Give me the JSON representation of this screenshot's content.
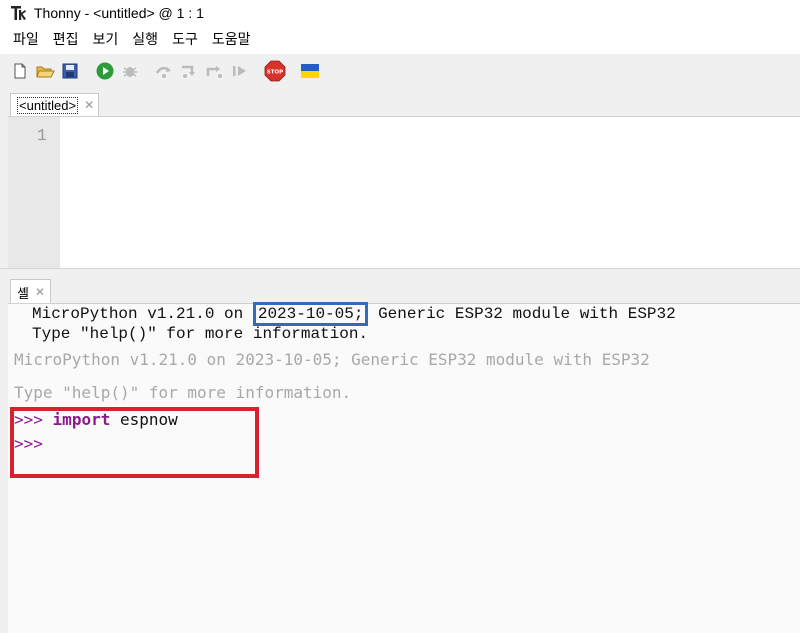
{
  "window": {
    "app_name": "Thonny",
    "separator": "-",
    "document": "<untitled>",
    "at": "@",
    "position": "1 : 1"
  },
  "menu": [
    "파일",
    "편집",
    "보기",
    "실행",
    "도구",
    "도움말"
  ],
  "toolbar": {
    "icons": [
      "new-file-icon",
      "open-file-icon",
      "save-file-icon",
      "run-icon",
      "debug-icon",
      "step-over-icon",
      "step-into-icon",
      "step-out-icon",
      "resume-icon",
      "stop-icon",
      "ukraine-flag-icon"
    ],
    "stop_label": "STOP",
    "colors": {
      "run": "#2e9b3a",
      "stop": "#d8322b",
      "flag_blue": "#1f5fbf",
      "flag_yellow": "#ffd500"
    }
  },
  "editor": {
    "tab_label": "<untitled>",
    "line_number": "1"
  },
  "shell": {
    "tab_label": "셸",
    "banner": {
      "prefix": "MicroPython v1.21.0 on ",
      "date": "2023-10-05;",
      "suffix": " Generic ESP32 module with ESP32",
      "help": "Type \"help()\" for more information."
    },
    "echo_line1": "MicroPython v1.21.0 on 2023-10-05; Generic ESP32 module with ESP32",
    "echo_line2": "Type \"help()\" for more information.",
    "prompt": ">>>",
    "keyword": "import",
    "module": "espnow",
    "colors": {
      "prompt": "#8b1a8b",
      "highlight_box": "#d4232f",
      "date_box": "#2f6db8"
    }
  }
}
